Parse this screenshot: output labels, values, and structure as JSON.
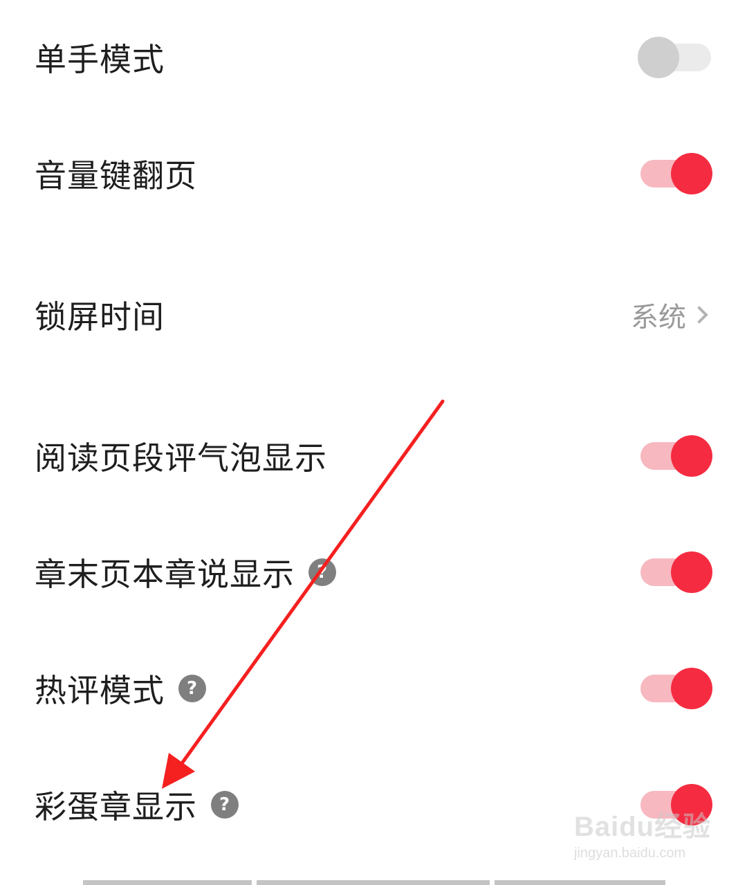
{
  "settings": [
    {
      "label": "单手模式",
      "control": "toggle",
      "on": false,
      "help": false
    },
    {
      "label": "音量键翻页",
      "control": "toggle",
      "on": true,
      "help": false
    },
    {
      "label": "锁屏时间",
      "control": "value",
      "value": "系统",
      "help": false
    },
    {
      "label": "阅读页段评气泡显示",
      "control": "toggle",
      "on": true,
      "help": false
    },
    {
      "label": "章末页本章说显示",
      "control": "toggle",
      "on": true,
      "help": true
    },
    {
      "label": "热评模式",
      "control": "toggle",
      "on": true,
      "help": true
    },
    {
      "label": "彩蛋章显示",
      "control": "toggle",
      "on": true,
      "help": true
    }
  ],
  "help_glyph": "?",
  "colors": {
    "toggle_on_knob": "#f52c41",
    "toggle_on_track": "#f7b8c0",
    "toggle_off_knob": "#cfcfcf",
    "toggle_off_track": "#ebebeb",
    "annotation_arrow": "#f52020"
  },
  "watermark": {
    "logo": "Baidu经验",
    "url": "jingyan.baidu.com"
  }
}
